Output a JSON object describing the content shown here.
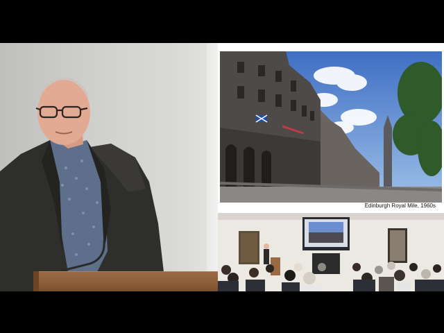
{
  "slide": {
    "caption": "Edinburgh Royal Mile, 1960s"
  },
  "colors": {
    "background": "#000000",
    "jacket": "#2e2e2a",
    "shirt": "#5d6f8a",
    "lectern": "#8a5c38",
    "sky": "#6f9bd8",
    "stone": "#4e4a48"
  },
  "icons": {
    "saltire_flag": "saltire-flag-icon"
  }
}
